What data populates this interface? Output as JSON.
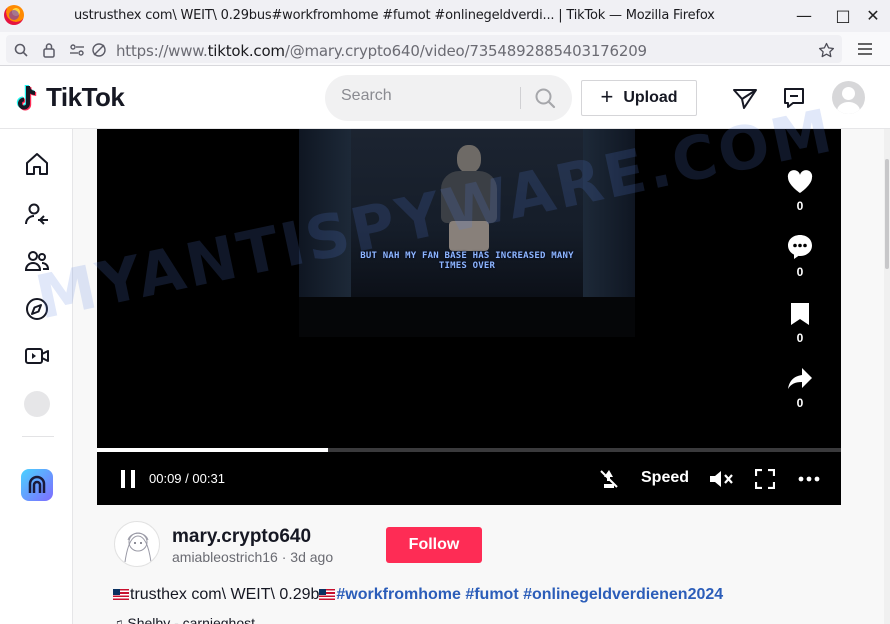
{
  "browser": {
    "window_title": "ustrusthex com\\ WEIT\\ 0.29bus#workfromhome #fumot #onlinegeldverdi... | TikTok — Mozilla Firefox",
    "url_prefix": "https://www.",
    "url_host": "tiktok.com",
    "url_path": "/@mary.crypto640/video/7354892885403176209",
    "minimize_icon": "minimize-icon",
    "maximize_icon": "maximize-icon",
    "close_icon": "close-icon"
  },
  "header": {
    "logo_text": "TikTok",
    "search_placeholder": "Search",
    "upload_label": "Upload",
    "icons": [
      "send-icon",
      "inbox-icon",
      "profile-avatar"
    ]
  },
  "sidebar": {
    "items": [
      "home-icon",
      "following-icon",
      "friends-icon",
      "explore-icon",
      "live-icon"
    ]
  },
  "video": {
    "caption_line1": "BUT NAH MY FAN BASE HAS INCREASED MANY",
    "caption_line2": "TIMES OVER",
    "progress": 0.31,
    "current_time": "00:09",
    "time_separator": "/",
    "duration": "00:31",
    "speed_label": "Speed",
    "actions": [
      {
        "icon": "heart-icon",
        "count": "0"
      },
      {
        "icon": "comment-icon",
        "count": "0"
      },
      {
        "icon": "bookmark-icon",
        "count": "0"
      },
      {
        "icon": "share-icon",
        "count": "0"
      }
    ]
  },
  "author": {
    "username": "mary.crypto640",
    "nickname": "amiableostrich16",
    "separator": "·",
    "posted": "3d ago",
    "follow_label": "Follow"
  },
  "description": {
    "text": "trusthex com\\ WEIT\\ 0.29b",
    "hashtags": "#workfromhome #fumot #onlinegeldverdienen2024",
    "music": "Shelby - carnieghost"
  },
  "watermark": "MYANTISPYWARE.COM",
  "colors": {
    "follow": "#fe2c55",
    "hashtag": "#2b5db9",
    "text": "#161823"
  }
}
